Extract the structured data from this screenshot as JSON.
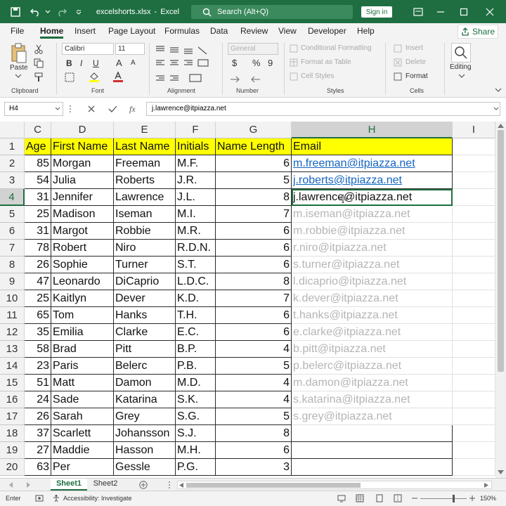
{
  "window": {
    "filename": "excelshorts.xlsx",
    "app": "Excel",
    "separator": "-",
    "search_placeholder": "Search (Alt+Q)",
    "signin": "Sign in"
  },
  "menu": {
    "tabs": [
      "File",
      "Home",
      "Insert",
      "Page Layout",
      "Formulas",
      "Data",
      "Review",
      "View",
      "Developer",
      "Help"
    ],
    "active": "Home",
    "share": "Share"
  },
  "ribbon": {
    "clipboard": {
      "paste": "Paste",
      "label": "Clipboard"
    },
    "font": {
      "name": "Calibri",
      "size": "11",
      "bold": "B",
      "italic": "I",
      "underline": "U",
      "grow": "A",
      "shrink": "A",
      "label": "Font"
    },
    "alignment": {
      "label": "Alignment"
    },
    "number": {
      "format": "General",
      "currency": "$",
      "percent": "%",
      "comma": "9",
      "label": "Number"
    },
    "styles": {
      "conditional": "Conditional Formatting",
      "table": "Format as Table",
      "cell": "Cell Styles",
      "label": "Styles"
    },
    "cells": {
      "insert": "Insert",
      "delete": "Delete",
      "format": "Format",
      "label": "Cells"
    },
    "editing": {
      "label": "Editing"
    }
  },
  "formula_bar": {
    "name_box": "H4",
    "fx": "fx",
    "value": "j.lawrence@itpiazza.net"
  },
  "columns": [
    "C",
    "D",
    "E",
    "F",
    "G",
    "H",
    "I"
  ],
  "selected_cell": "H4",
  "table": {
    "headers": [
      "Age",
      "First Name",
      "Last Name",
      "Initials",
      "Name Length",
      "Email"
    ],
    "rows": [
      [
        "85",
        "Morgan",
        "Freeman",
        "M.F.",
        "6",
        "m.freeman@itpiazza.net"
      ],
      [
        "54",
        "Julia",
        "Roberts",
        "J.R.",
        "5",
        "j.roberts@itpiazza.net"
      ],
      [
        "31",
        "Jennifer",
        "Lawrence",
        "J.L.",
        "8",
        "j.lawrence@itpiazza.net"
      ],
      [
        "25",
        "Madison",
        "Iseman",
        "M.I.",
        "7",
        "m.iseman@itpiazza.net"
      ],
      [
        "31",
        "Margot",
        "Robbie",
        "M.R.",
        "6",
        "m.robbie@itpiazza.net"
      ],
      [
        "78",
        "Robert",
        "Niro",
        "R.D.N.",
        "6",
        "r.niro@itpiazza.net"
      ],
      [
        "26",
        "Sophie",
        "Turner",
        "S.T.",
        "6",
        "s.turner@itpiazza.net"
      ],
      [
        "47",
        "Leonardo",
        "DiCaprio",
        "L.D.C.",
        "8",
        "l.dicaprio@itpiazza.net"
      ],
      [
        "25",
        "Kaitlyn",
        "Dever",
        "K.D.",
        "7",
        "k.dever@itpiazza.net"
      ],
      [
        "65",
        "Tom",
        "Hanks",
        "T.H.",
        "6",
        "t.hanks@itpiazza.net"
      ],
      [
        "35",
        "Emilia",
        "Clarke",
        "E.C.",
        "6",
        "e.clarke@itpiazza.net"
      ],
      [
        "58",
        "Brad",
        "Pitt",
        "B.P.",
        "4",
        "b.pitt@itpiazza.net"
      ],
      [
        "23",
        "Paris",
        "Belerc",
        "P.B.",
        "5",
        "p.belerc@itpiazza.net"
      ],
      [
        "51",
        "Matt",
        "Damon",
        "M.D.",
        "4",
        "m.damon@itpiazza.net"
      ],
      [
        "24",
        "Sade",
        "Katarina",
        "S.K.",
        "4",
        "s.katarina@itpiazza.net"
      ],
      [
        "26",
        "Sarah",
        "Grey",
        "S.G.",
        "5",
        "s.grey@itpiazza.net"
      ],
      [
        "37",
        "Scarlett",
        "Johansson",
        "S.J.",
        "8",
        ""
      ],
      [
        "27",
        "Maddie",
        "Hasson",
        "M.H.",
        "6",
        ""
      ],
      [
        "63",
        "Per",
        "Gessle",
        "P.G.",
        "3",
        ""
      ]
    ],
    "email_states": [
      "link",
      "link",
      "active",
      "ghost",
      "ghost",
      "ghost",
      "ghost",
      "ghost",
      "ghost",
      "ghost",
      "ghost",
      "ghost",
      "ghost",
      "ghost",
      "ghost",
      "ghost",
      "blank",
      "blank",
      "blank"
    ]
  },
  "sheets": [
    "Sheet1",
    "Sheet2"
  ],
  "active_sheet": "Sheet1",
  "status": {
    "mode": "Enter",
    "accessibility": "Accessibility: Investigate",
    "zoom": "150%"
  }
}
